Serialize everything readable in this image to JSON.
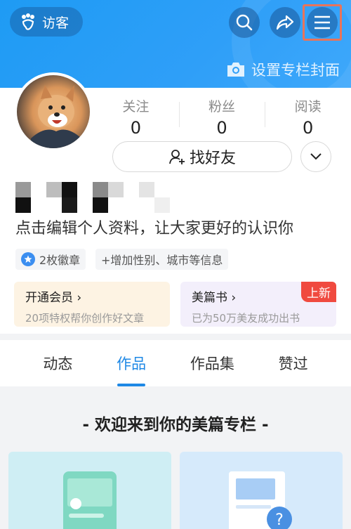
{
  "header": {
    "visitor_label": "访客",
    "cover_label": "设置专栏封面"
  },
  "stats": [
    {
      "label": "关注",
      "value": "0"
    },
    {
      "label": "粉丝",
      "value": "0"
    },
    {
      "label": "阅读",
      "value": "0"
    }
  ],
  "profile": {
    "find_friends_label": "找好友",
    "bio": "点击编辑个人资料，让大家更好的认识你",
    "badge_tag": "2枚徽章",
    "info_tag": "+增加性别、城市等信息"
  },
  "promos": {
    "vip": {
      "title": "开通会员",
      "subtitle": "20项特权帮你创作好文章"
    },
    "book": {
      "title": "美篇书",
      "subtitle": "已为50万美友成功出书",
      "badge": "上新"
    }
  },
  "tabs": [
    "动态",
    "作品",
    "作品集",
    "赞过"
  ],
  "active_tab": "作品",
  "welcome": "- 欢迎来到你的美篇专栏 -",
  "colors": {
    "accent": "#1e88e5",
    "header": "#2f9ff8",
    "highlight": "#e8745a",
    "new_badge": "#f04a3f"
  }
}
